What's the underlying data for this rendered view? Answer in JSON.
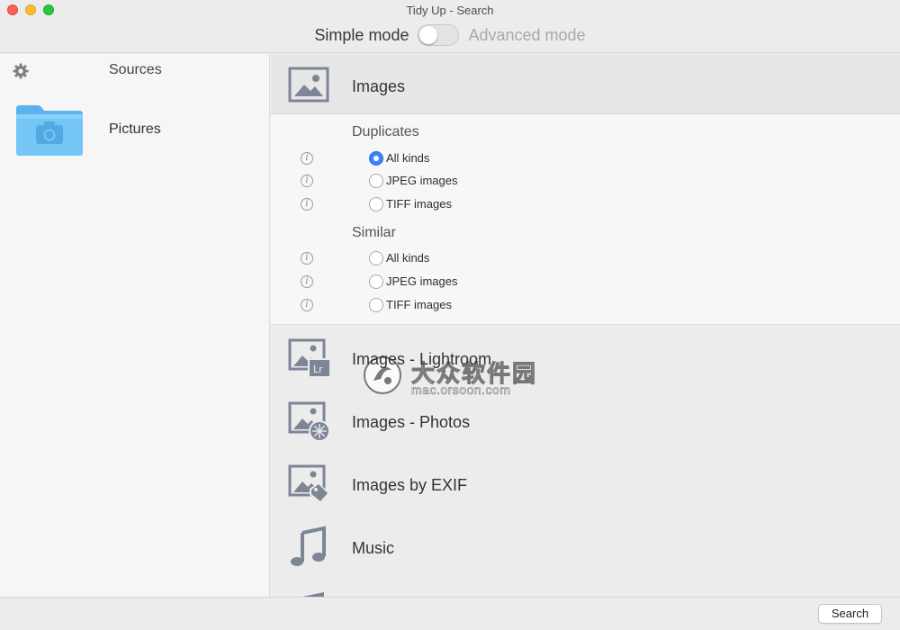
{
  "window": {
    "title": "Tidy Up - Search"
  },
  "mode": {
    "simple_label": "Simple mode",
    "advanced_label": "Advanced mode",
    "advanced_enabled": false
  },
  "sidebar": {
    "settings_icon": "gear-icon",
    "header": "Sources",
    "sources": [
      {
        "label": "Pictures",
        "icon": "pictures-folder-icon",
        "color": "#6cc1f5"
      }
    ]
  },
  "categories": [
    {
      "label": "Images",
      "icon": "image-icon",
      "expanded": true
    },
    {
      "label": "Images - Lightroom",
      "icon": "image-lightroom-icon"
    },
    {
      "label": "Images - Photos",
      "icon": "image-photos-icon"
    },
    {
      "label": "Images by EXIF",
      "icon": "image-exif-icon"
    },
    {
      "label": "Music",
      "icon": "music-note-icon"
    }
  ],
  "options": {
    "groups": [
      {
        "title": "Duplicates",
        "items": [
          {
            "label": "All kinds",
            "selected": true
          },
          {
            "label": "JPEG images",
            "selected": false
          },
          {
            "label": "TIFF images",
            "selected": false
          }
        ]
      },
      {
        "title": "Similar",
        "items": [
          {
            "label": "All kinds",
            "selected": false
          },
          {
            "label": "JPEG images",
            "selected": false
          },
          {
            "label": "TIFF images",
            "selected": false
          }
        ]
      }
    ]
  },
  "watermark": {
    "name": "大众软件园",
    "url": "mac.orsoon.com"
  },
  "footer": {
    "search_label": "Search"
  },
  "colors": {
    "accent": "#3b82f7",
    "icon_gray": "#7d8597",
    "folder_blue": "#6cc1f5"
  }
}
